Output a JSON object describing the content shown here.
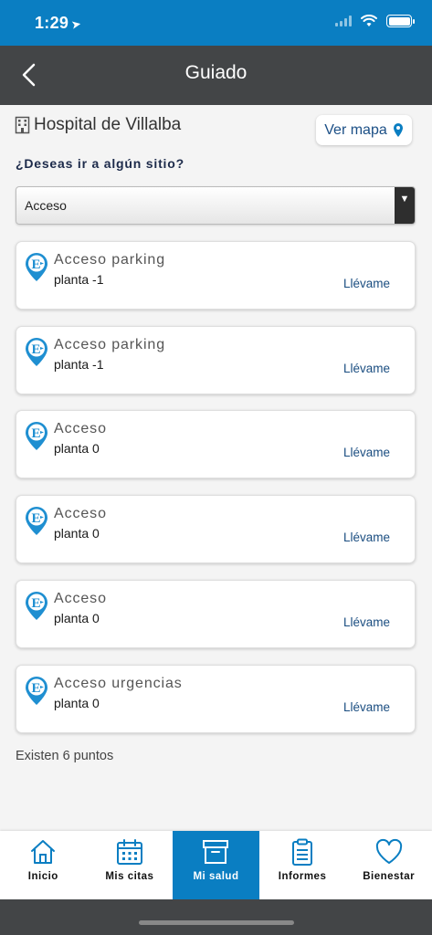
{
  "status_bar": {
    "time": "1:29"
  },
  "nav": {
    "title": "Guiado"
  },
  "hospital": {
    "name": "Hospital de Villalba",
    "map_button_label": "Ver mapa"
  },
  "destination": {
    "question": "¿Deseas ir a algún sitio?",
    "selected": "Acceso"
  },
  "points": [
    {
      "title": "Acceso parking",
      "floor": "planta -1",
      "action": "Llévame"
    },
    {
      "title": "Acceso parking",
      "floor": "planta -1",
      "action": "Llévame"
    },
    {
      "title": "Acceso",
      "floor": "planta 0",
      "action": "Llévame"
    },
    {
      "title": "Acceso",
      "floor": "planta 0",
      "action": "Llévame"
    },
    {
      "title": "Acceso",
      "floor": "planta 0",
      "action": "Llévame"
    },
    {
      "title": "Acceso urgencias",
      "floor": "planta 0",
      "action": "Llévame"
    }
  ],
  "points_count": "Existen 6 puntos",
  "tabs": [
    {
      "label": "Inicio",
      "icon": "home-icon",
      "active": false
    },
    {
      "label": "Mis citas",
      "icon": "calendar-icon",
      "active": false
    },
    {
      "label": "Mi salud",
      "icon": "archive-box-icon",
      "active": true
    },
    {
      "label": "Informes",
      "icon": "clipboard-icon",
      "active": false
    },
    {
      "label": "Bienestar",
      "icon": "heart-icon",
      "active": false
    }
  ],
  "colors": {
    "primary": "#0a7ec2",
    "header": "#434547",
    "link": "#1a4d80"
  }
}
